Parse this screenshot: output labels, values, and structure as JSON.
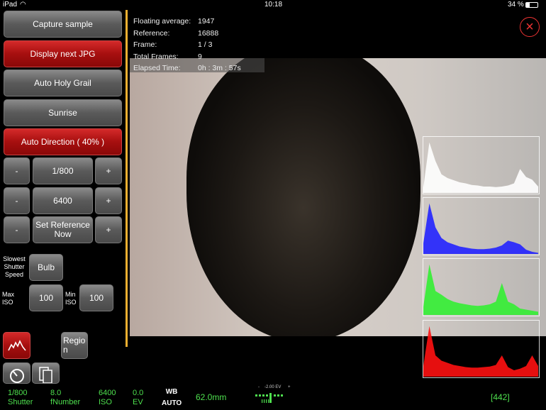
{
  "status": {
    "device": "iPad",
    "time": "10:18",
    "battery": "34 %"
  },
  "buttons": {
    "capture": "Capture sample",
    "display_next": "Display next JPG",
    "auto_holy_grail": "Auto Holy Grail",
    "sunrise": "Sunrise",
    "auto_direction": "Auto Direction ( 40% )"
  },
  "steppers": [
    {
      "minus": "-",
      "value": "1/800",
      "plus": "+"
    },
    {
      "minus": "-",
      "value": "6400",
      "plus": "+"
    },
    {
      "minus": "-",
      "value": "Set Reference Now",
      "plus": "+"
    }
  ],
  "limits": {
    "slowest_label": "Slowest Shutter Speed",
    "slowest_value": "Bulb",
    "max_iso_label": "Max ISO",
    "max_iso_value": "100",
    "min_iso_label": "Min ISO",
    "min_iso_value": "100"
  },
  "region_label": "Regio n",
  "info": [
    {
      "k": "Floating average:",
      "v": "1947"
    },
    {
      "k": "Reference:",
      "v": "16888"
    },
    {
      "k": "Frame:",
      "v": "1 / 3"
    },
    {
      "k": "Total Frames:",
      "v": "9"
    },
    {
      "k": "Elapsed Time:",
      "v": "0h : 3m : 57s"
    }
  ],
  "histograms": [
    {
      "channel": "luminance",
      "color": "#ffffff",
      "bins": [
        10,
        95,
        60,
        35,
        28,
        24,
        20,
        18,
        15,
        14,
        12,
        12,
        11,
        12,
        14,
        18,
        45,
        30,
        25,
        12
      ]
    },
    {
      "channel": "blue",
      "color": "#2222ff",
      "bins": [
        20,
        95,
        50,
        30,
        22,
        18,
        14,
        12,
        10,
        9,
        9,
        10,
        12,
        16,
        25,
        22,
        18,
        8,
        4,
        2
      ]
    },
    {
      "channel": "green",
      "color": "#33ee33",
      "bins": [
        15,
        95,
        45,
        38,
        30,
        25,
        22,
        20,
        18,
        17,
        18,
        20,
        25,
        60,
        25,
        20,
        12,
        10,
        8,
        6
      ]
    },
    {
      "channel": "red",
      "color": "#ff1111",
      "bins": [
        20,
        95,
        40,
        30,
        26,
        22,
        20,
        18,
        17,
        17,
        18,
        19,
        22,
        40,
        18,
        12,
        15,
        20,
        40,
        20
      ]
    }
  ],
  "bottom": {
    "shutter": "1/800",
    "shutter_label": "Shutter",
    "fnumber": "8.0",
    "fnumber_label": "fNumber",
    "iso": "6400",
    "iso_label": "ISO",
    "ev": "0.0",
    "ev_label": "EV",
    "wb": "WB",
    "wb_value": "AUTO",
    "focal": "62.0mm",
    "ev_meter": "-2.00 EV",
    "ev_minus": "-",
    "ev_plus": "+",
    "count": "[442]"
  },
  "close_symbol": "×",
  "colors": {
    "accent": "#f0b030",
    "bottom_text": "#4ee04e",
    "red_button": "#b01515"
  }
}
